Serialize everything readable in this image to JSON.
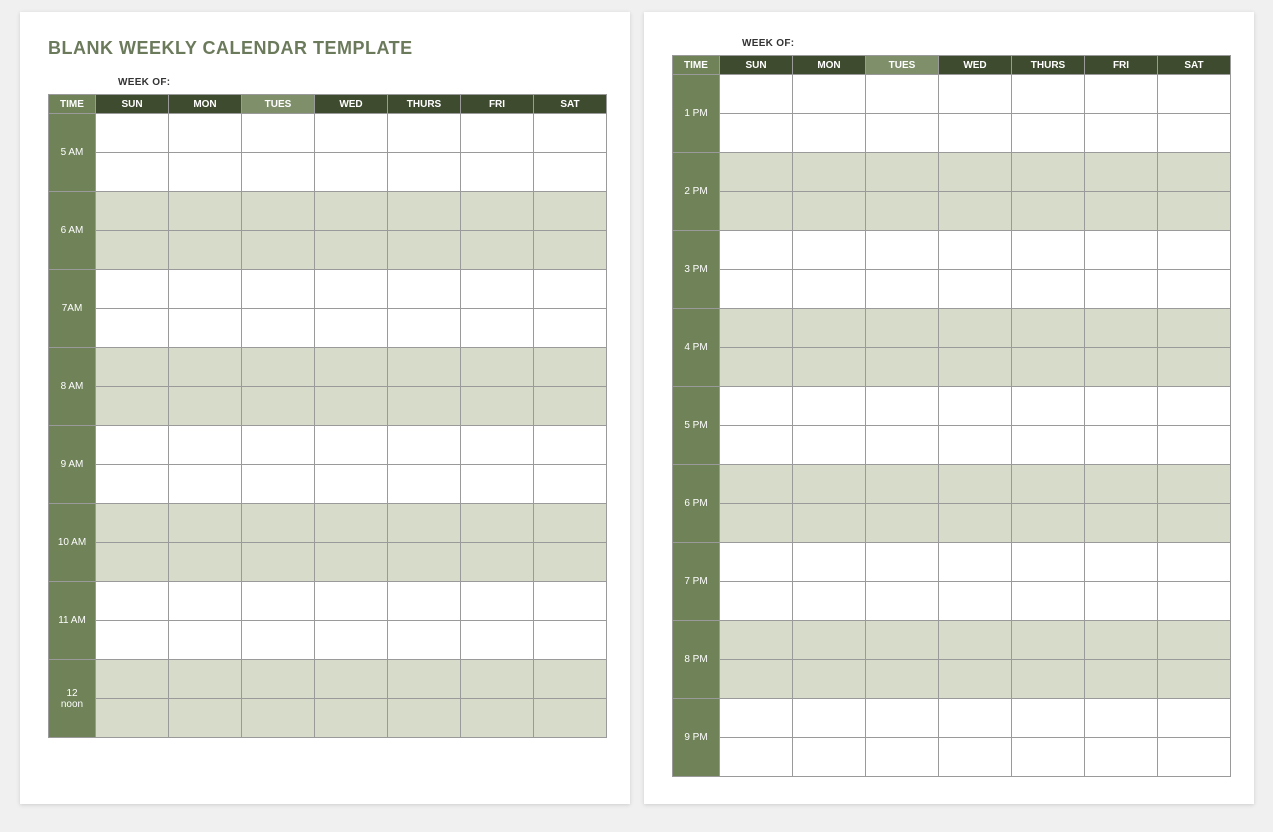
{
  "title": "BLANK WEEKLY CALENDAR TEMPLATE",
  "weekof_label": "WEEK OF:",
  "headers": {
    "time": "TIME",
    "days": [
      "SUN",
      "MON",
      "TUES",
      "WED",
      "THURS",
      "FRI",
      "SAT"
    ]
  },
  "page1_times": [
    "5 AM",
    "6 AM",
    "7AM",
    "8 AM",
    "9 AM",
    "10 AM",
    "11 AM",
    "12 noon"
  ],
  "page2_times": [
    "1 PM",
    "2 PM",
    "3 PM",
    "4 PM",
    "5 PM",
    "6 PM",
    "7 PM",
    "8 PM",
    "9 PM"
  ],
  "stripe_start_page1": 1,
  "stripe_start_page2": 1
}
